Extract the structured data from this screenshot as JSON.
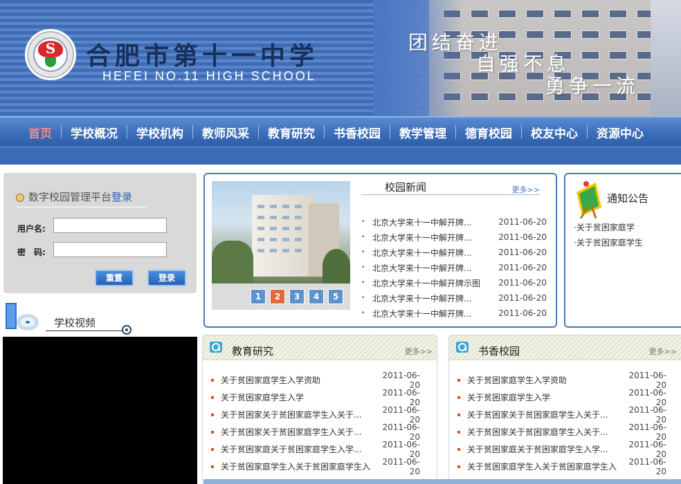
{
  "header": {
    "school_name": "合肥市第十一中学",
    "school_name_en": "HEFEI NO.11 HIGH SCHOOL",
    "slogans": [
      "团结奋进",
      "自强不息",
      "勇争一流"
    ]
  },
  "nav": {
    "items": [
      "首页",
      "学校概况",
      "学校机构",
      "教师风采",
      "教育研究",
      "书香校园",
      "教学管理",
      "德育校园",
      "校友中心",
      "资源中心"
    ],
    "active_index": 0
  },
  "login": {
    "title_prefix": "数字校园管理平台",
    "title_link": "登录",
    "username_label": "用户名:",
    "password_label": "密　码:",
    "username_value": "",
    "password_value": "",
    "reset_label": "重置",
    "submit_label": "登录"
  },
  "video": {
    "title": "学校视频"
  },
  "campus_news": {
    "title": "校园新闻",
    "more": "更多>>",
    "pager": [
      "1",
      "2",
      "3",
      "4",
      "5"
    ],
    "active_page": "2",
    "items": [
      {
        "title": "北京大学来十一中解开牌...",
        "date": "2011-06-20"
      },
      {
        "title": "北京大学来十一中解开牌...",
        "date": "2011-06-20"
      },
      {
        "title": "北京大学来十一中解开牌...",
        "date": "2011-06-20"
      },
      {
        "title": "北京大学来十一中解开牌...",
        "date": "2011-06-20"
      },
      {
        "title": "北京大学来十一中解开牌示图",
        "date": "2011-06-20"
      },
      {
        "title": "北京大学来十一中解开牌...",
        "date": "2011-06-20"
      },
      {
        "title": "北京大学来十一中解开牌...",
        "date": "2011-06-20"
      }
    ]
  },
  "notice": {
    "title": "通知公告",
    "items": [
      "关于贫困家庭学",
      "关于贫困家庭学生"
    ]
  },
  "research": {
    "title": "教育研究",
    "more": "更多>>",
    "items": [
      {
        "title": "关于贫困家庭学生入学资助",
        "date": "2011-06-20"
      },
      {
        "title": "关于贫困家庭学生入学",
        "date": "2011-06-20"
      },
      {
        "title": "关于贫困家关于贫困家庭学生入关于...",
        "date": "2011-06-20"
      },
      {
        "title": "关于贫困家关于贫困家庭学生入关于...",
        "date": "2011-06-20"
      },
      {
        "title": "关于贫困家庭关于贫困家庭学生入学...",
        "date": "2011-06-20"
      },
      {
        "title": "关于贫困家庭学生入关于贫困家庭学生入",
        "date": "2011-06-20"
      }
    ]
  },
  "reading": {
    "title": "书香校园",
    "more": "更多>>",
    "items": [
      {
        "title": "关于贫困家庭学生入学资助",
        "date": "2011-06-20"
      },
      {
        "title": "关于贫困家庭学生入学",
        "date": "2011-06-20"
      },
      {
        "title": "关于贫困家关于贫困家庭学生入关于...",
        "date": "2011-06-20"
      },
      {
        "title": "关于贫困家关于贫困家庭学生入关于...",
        "date": "2011-06-20"
      },
      {
        "title": "关于贫困家庭关于贫困家庭学生入学...",
        "date": "2011-06-20"
      },
      {
        "title": "关于贫困家庭学生入关于贫困家庭学生入",
        "date": "2011-06-20"
      }
    ]
  },
  "colors": {
    "nav_blue": "#3e6fbb",
    "nav_active": "#f18a80",
    "box_border": "#4a78b8",
    "bullet_orange": "#d9531e"
  }
}
